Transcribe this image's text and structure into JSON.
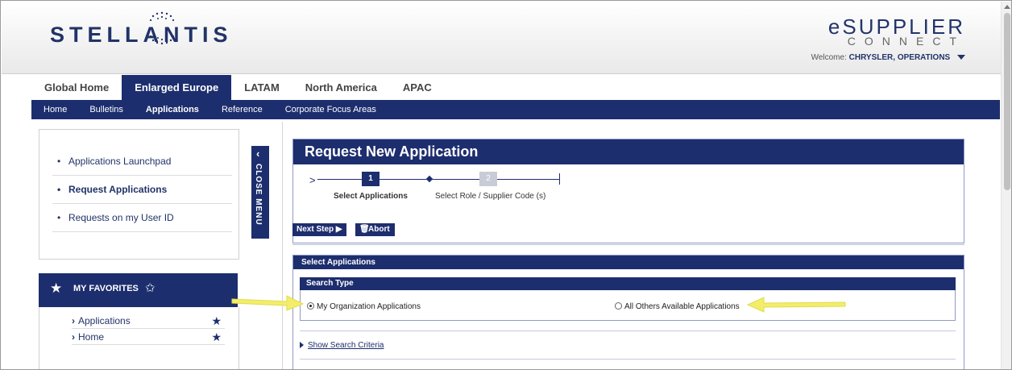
{
  "header": {
    "brand": "STELLANTIS",
    "product_line1": "eSUPPLIER",
    "product_line2": "CONNECT",
    "welcome_label": "Welcome:",
    "welcome_user": "CHRYSLER, OPERATIONS"
  },
  "region_tabs": [
    {
      "label": "Global Home",
      "active": false
    },
    {
      "label": "Enlarged Europe",
      "active": true
    },
    {
      "label": "LATAM",
      "active": false
    },
    {
      "label": "North America",
      "active": false
    },
    {
      "label": "APAC",
      "active": false
    }
  ],
  "navbar": [
    {
      "label": "Home",
      "active": false
    },
    {
      "label": "Bulletins",
      "active": false
    },
    {
      "label": "Applications",
      "active": true
    },
    {
      "label": "Reference",
      "active": false
    },
    {
      "label": "Corporate Focus Areas",
      "active": false
    }
  ],
  "left_menu": {
    "items": [
      {
        "label": "Applications Launchpad",
        "bold": false
      },
      {
        "label": "Request Applications",
        "bold": true
      },
      {
        "label": "Requests on my User ID",
        "bold": false
      }
    ],
    "close_menu": "CLOSE MENU"
  },
  "favorites": {
    "title": "MY FAVORITES",
    "items": [
      "Applications",
      "Home"
    ]
  },
  "request": {
    "title": "Request New Application",
    "steps": [
      {
        "number": "1",
        "label": "Select Applications",
        "current": true
      },
      {
        "number": "2",
        "label": "Select Role / Supplier Code (s)",
        "current": false
      }
    ],
    "next_button": "Next Step",
    "abort_button": "Abort"
  },
  "select_applications": {
    "header": "Select Applications",
    "search_type_header": "Search Type",
    "option_mine": "My Organization Applications",
    "option_others": "All Others Available Applications",
    "selected": "option_mine",
    "show_criteria": "Show Search Criteria"
  },
  "colors": {
    "navy": "#1d2e6e",
    "annotation_arrow": "#f2ee6a"
  }
}
